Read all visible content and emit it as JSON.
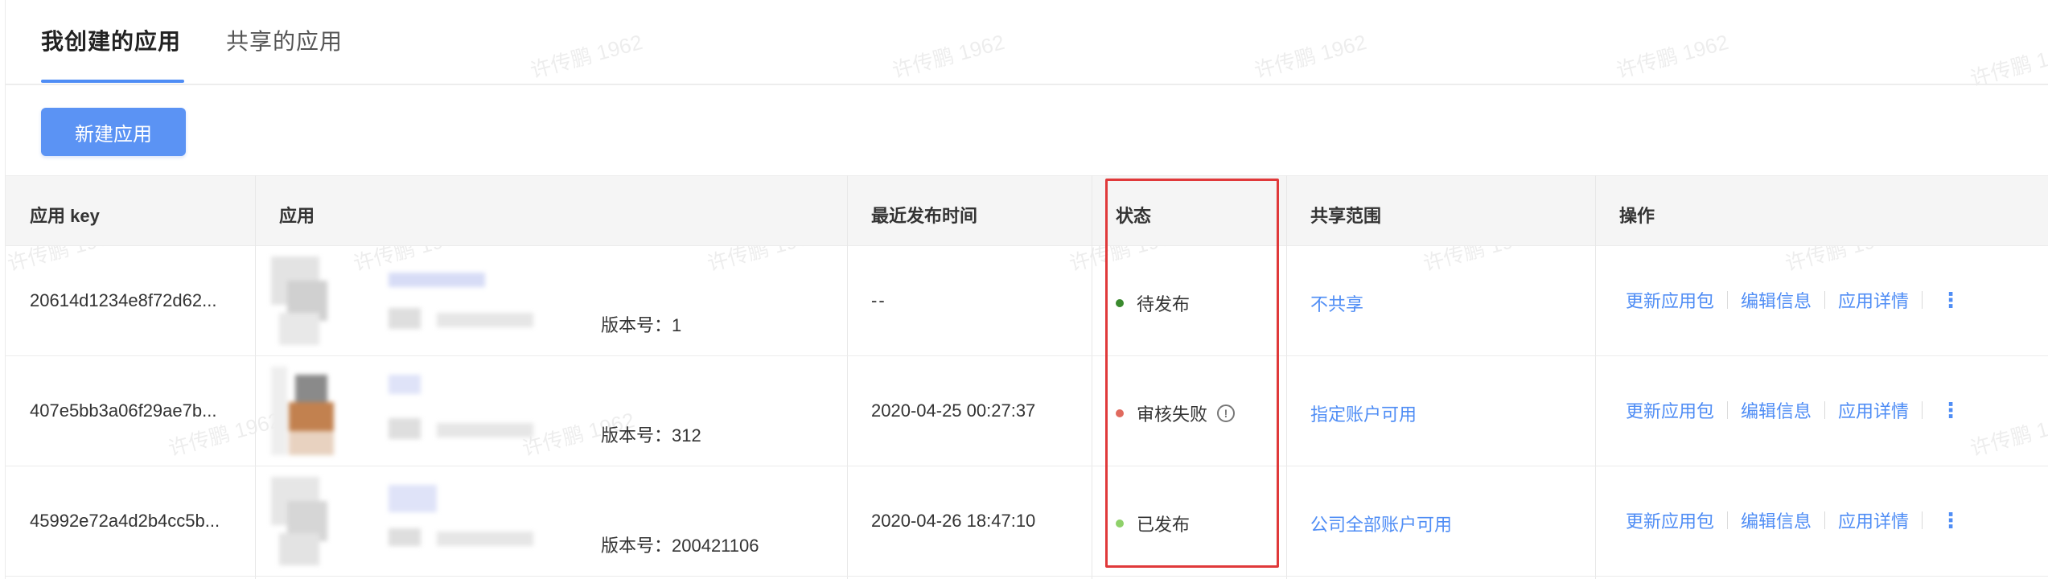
{
  "tabs": [
    {
      "label": "我创建的应用",
      "active": true
    },
    {
      "label": "共享的应用",
      "active": false
    }
  ],
  "toolbar": {
    "new_app_label": "新建应用"
  },
  "table": {
    "columns": [
      "应用 key",
      "应用",
      "最近发布时间",
      "状态",
      "共享范围",
      "操作"
    ],
    "rows": [
      {
        "key": "20614d1234e8f72d62...",
        "version": "版本号：1",
        "publish_time": "--",
        "status": "待发布",
        "status_color": "#3a8a2e",
        "has_info": false,
        "share": "不共享"
      },
      {
        "key": "407e5bb3a06f29ae7b...",
        "version": "版本号：312",
        "publish_time": "2020-04-25 00:27:37",
        "status": "审核失败",
        "status_color": "#e06a5e",
        "has_info": true,
        "share": "指定账户可用"
      },
      {
        "key": "45992e72a4d2b4cc5b...",
        "version": "版本号：200421106",
        "publish_time": "2020-04-26 18:47:10",
        "status": "已发布",
        "status_color": "#8fd16a",
        "has_info": false,
        "share": "公司全部账户可用"
      }
    ],
    "operations": [
      "更新应用包",
      "编辑信息",
      "应用详情"
    ]
  },
  "watermark": "许传鹏 1962",
  "colors": {
    "accent": "#4f8df5",
    "button_bg": "#5b93f4",
    "highlight": "#e0393a"
  },
  "icons": {
    "info": "info-circle-icon",
    "more": "more-vertical-icon"
  }
}
